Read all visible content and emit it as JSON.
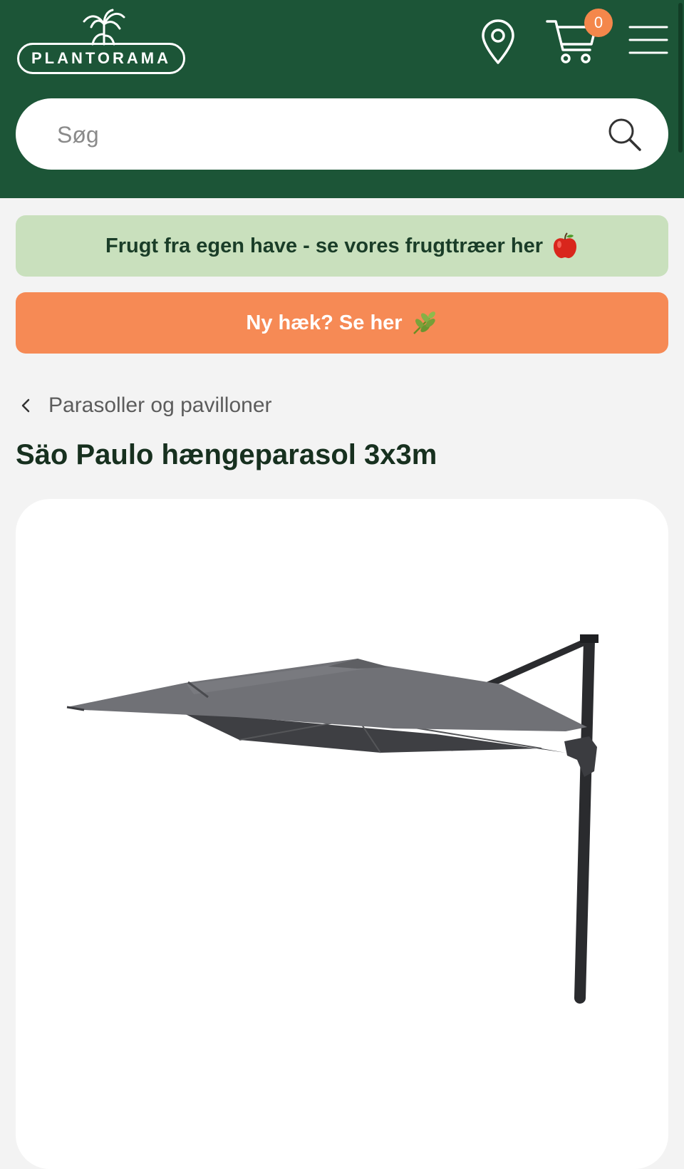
{
  "header": {
    "logo_text": "PLANTORAMA",
    "cart_count": "0",
    "bg_color": "#1c5537",
    "icons": [
      "location-icon",
      "cart-icon",
      "menu-icon"
    ]
  },
  "search": {
    "placeholder": "Søg"
  },
  "banners": [
    {
      "text": "Frugt fra egen have - se vores frugttræer her",
      "emoji": "apple-icon",
      "color": "#c9e0bd"
    },
    {
      "text": "Ny hæk? Se her",
      "emoji": "leaf-icon",
      "color": "#f68a55"
    }
  ],
  "breadcrumb": {
    "label": "Parasoller og pavilloner"
  },
  "product": {
    "title": "Säo Paulo hængeparasol 3x3m",
    "image": "hanging-parasol-image"
  }
}
